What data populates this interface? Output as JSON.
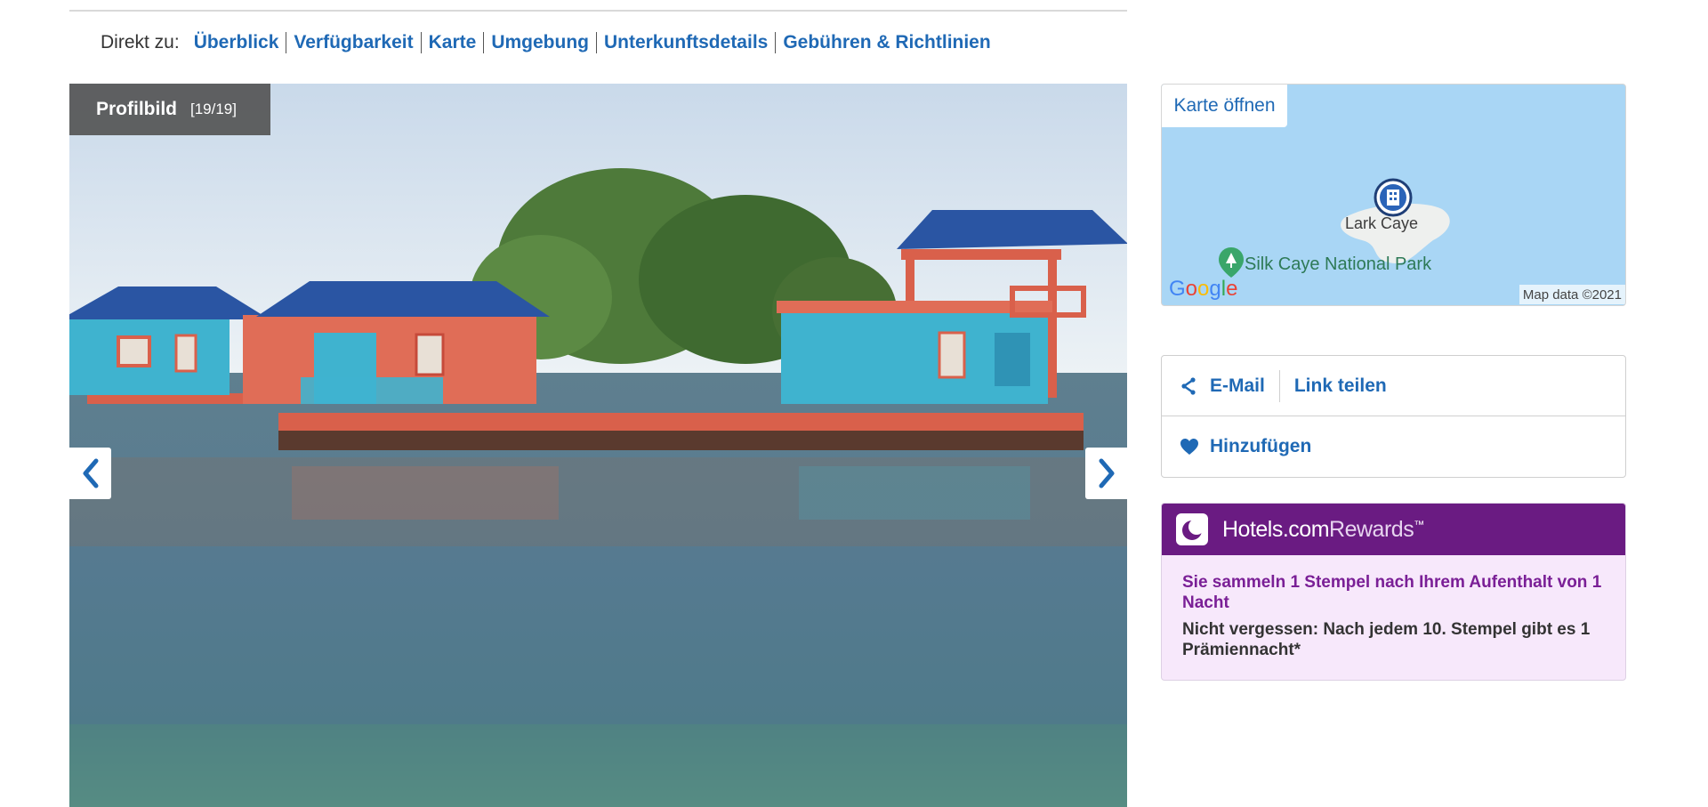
{
  "jump_nav": {
    "lead": "Direkt zu:",
    "links": [
      "Überblick",
      "Verfügbarkeit",
      "Karte",
      "Umgebung",
      "Unterkunftsdetails",
      "Gebühren & Richtlinien"
    ]
  },
  "gallery": {
    "caption_title": "Profilbild",
    "caption_count": "[19/19]",
    "prev_icon": "chevron-left-icon",
    "next_icon": "chevron-right-icon",
    "thumbnail_colors": [
      "#7fb2df",
      "#2c2622",
      "#3a2b24",
      "#7a5e4a",
      "#3d7fb6",
      "#3a3834",
      "#8fb3d6",
      "#6d6a48",
      "#7a1e22"
    ]
  },
  "map": {
    "open_label": "Karte öffnen",
    "label_island": "Lark Caye",
    "label_park": "Silk Caye National Park",
    "credit": "Map data ©2021",
    "google_logo": "Google",
    "marker_icon": "hotel-marker-icon",
    "park_icon": "park-pin-icon",
    "water_color": "#a9d6f5"
  },
  "share": {
    "email_label": "E-Mail",
    "link_label": "Link teilen",
    "favorite_label": "Hinzufügen",
    "share_icon": "share-icon",
    "heart_icon": "heart-icon"
  },
  "rewards": {
    "brand_main": "Hotels.com",
    "brand_suffix": "Rewards",
    "tm": "™",
    "message": "Sie sammeln 1 Stempel nach Ihrem Aufenthalt von 1 Nacht",
    "note": "Nicht vergessen: Nach jedem 10. Stempel gibt es 1 Prämiennacht*",
    "moon_icon": "moon-icon",
    "accent_color": "#6a1b82"
  },
  "colors": {
    "link": "#1f69b5",
    "rewards_text": "#7a1f96"
  }
}
